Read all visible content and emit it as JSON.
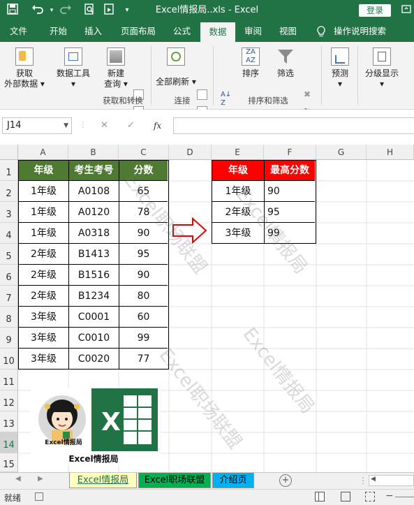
{
  "window": {
    "title": "Excel情报局..xls  -  Excel",
    "login_label": "登录"
  },
  "quick_access": {
    "save_icon": "save-icon",
    "undo_icon": "undo-icon",
    "redo_icon": "redo-icon",
    "print_preview_icon": "print-preview-icon",
    "touch_mode_icon": "touch-mode-icon",
    "customize_icon": "customize-icon"
  },
  "tabs": [
    "文件",
    "开始",
    "插入",
    "页面布局",
    "公式",
    "数据",
    "审阅",
    "视图"
  ],
  "active_tab": "数据",
  "tell_me": "操作说明搜索",
  "ribbon": {
    "get_external": [
      "获取",
      "外部数据"
    ],
    "data_tools": "数据工具",
    "new_query": [
      "新建",
      "查询"
    ],
    "group_get_transform": "获取和转换",
    "refresh_all": "全部刷新",
    "group_connections": "连接",
    "sort": "排序",
    "filter": "筛选",
    "group_sort_filter": "排序和筛选",
    "forecast": "预测",
    "outline": "分级显示"
  },
  "formula_bar": {
    "name_box": "J14",
    "cancel": "✕",
    "enter": "✓",
    "fx": "fx",
    "value": ""
  },
  "columns": [
    "A",
    "B",
    "C",
    "D",
    "E",
    "F",
    "G",
    "H"
  ],
  "rows": [
    "1",
    "2",
    "3",
    "4",
    "5",
    "6",
    "7",
    "8",
    "9",
    "10",
    "11",
    "12",
    "13",
    "14",
    "15"
  ],
  "table1": {
    "headers": [
      "年级",
      "考生考号",
      "分数"
    ],
    "rows": [
      [
        "1年级",
        "A0108",
        "65"
      ],
      [
        "1年级",
        "A0120",
        "78"
      ],
      [
        "1年级",
        "A0318",
        "90"
      ],
      [
        "2年级",
        "B1413",
        "95"
      ],
      [
        "2年级",
        "B1516",
        "90"
      ],
      [
        "2年级",
        "B1234",
        "80"
      ],
      [
        "3年级",
        "C0001",
        "60"
      ],
      [
        "3年级",
        "C0010",
        "99"
      ],
      [
        "3年级",
        "C0020",
        "77"
      ]
    ]
  },
  "table2": {
    "headers": [
      "年级",
      "最高分数"
    ],
    "rows": [
      [
        "1年级",
        "90"
      ],
      [
        "2年级",
        "95"
      ],
      [
        "3年级",
        "99"
      ]
    ]
  },
  "logo_caption": "Excel情报局",
  "avatar_badge": "Excel情报局",
  "watermarks": [
    "Excel职场联盟",
    "Excel情报局",
    "Excel职场联盟",
    "Excel情报局"
  ],
  "sheets": [
    "Excel情报局",
    "Excel职场联盟",
    "介绍页"
  ],
  "active_sheet": "Excel情报局",
  "status": {
    "ready": "就绪"
  },
  "colors": {
    "excel_green": "#217346",
    "header_green": "#4e7a32",
    "header_red": "#ff0000",
    "tab_yellow": "#ffffc0",
    "tab_green": "#00b050",
    "tab_blue": "#00b0f0"
  }
}
